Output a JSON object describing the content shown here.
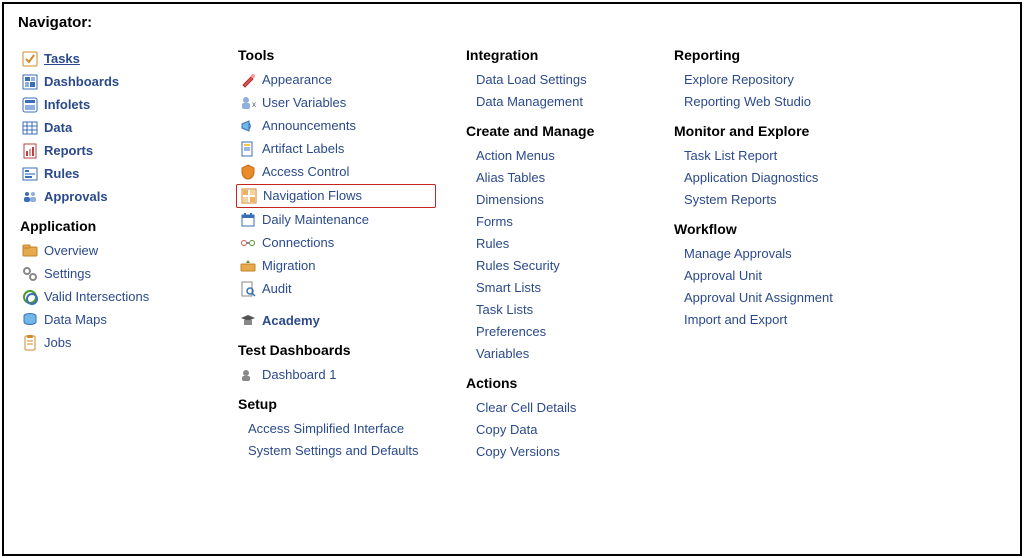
{
  "title": "Navigator:",
  "col1": {
    "primary": [
      {
        "name": "tasks",
        "label": "Tasks",
        "icon": "tasks",
        "active": true
      },
      {
        "name": "dashboards",
        "label": "Dashboards",
        "icon": "dashboards"
      },
      {
        "name": "infolets",
        "label": "Infolets",
        "icon": "infolets"
      },
      {
        "name": "data",
        "label": "Data",
        "icon": "data"
      },
      {
        "name": "reports",
        "label": "Reports",
        "icon": "reports"
      },
      {
        "name": "rules",
        "label": "Rules",
        "icon": "rules"
      },
      {
        "name": "approvals",
        "label": "Approvals",
        "icon": "approvals"
      }
    ],
    "application_heading": "Application",
    "application": [
      {
        "name": "overview",
        "label": "Overview",
        "icon": "overview"
      },
      {
        "name": "settings",
        "label": "Settings",
        "icon": "settings"
      },
      {
        "name": "valid-intersections",
        "label": "Valid Intersections",
        "icon": "intersections"
      },
      {
        "name": "data-maps",
        "label": "Data Maps",
        "icon": "datamaps"
      },
      {
        "name": "jobs",
        "label": "Jobs",
        "icon": "jobs"
      }
    ]
  },
  "col2": {
    "tools_heading": "Tools",
    "tools": [
      {
        "name": "appearance",
        "label": "Appearance",
        "icon": "appearance"
      },
      {
        "name": "user-variables",
        "label": "User Variables",
        "icon": "user-variables"
      },
      {
        "name": "announcements",
        "label": "Announcements",
        "icon": "announcements"
      },
      {
        "name": "artifact-labels",
        "label": "Artifact Labels",
        "icon": "artifact-labels"
      },
      {
        "name": "access-control",
        "label": "Access Control",
        "icon": "access-control"
      },
      {
        "name": "navigation-flows",
        "label": "Navigation Flows",
        "icon": "navigation-flows",
        "highlight": true
      },
      {
        "name": "daily-maintenance",
        "label": "Daily Maintenance",
        "icon": "daily-maintenance"
      },
      {
        "name": "connections",
        "label": "Connections",
        "icon": "connections"
      },
      {
        "name": "migration",
        "label": "Migration",
        "icon": "migration"
      },
      {
        "name": "audit",
        "label": "Audit",
        "icon": "audit"
      }
    ],
    "academy": {
      "label": "Academy",
      "icon": "academy"
    },
    "test_dashboards_heading": "Test Dashboards",
    "test_dashboards": [
      {
        "name": "dashboard-1",
        "label": "Dashboard 1",
        "icon": "dashboard-item"
      }
    ],
    "setup_heading": "Setup",
    "setup": [
      "Access Simplified Interface",
      "System Settings and Defaults"
    ]
  },
  "col3": {
    "integration_heading": "Integration",
    "integration": [
      "Data Load Settings",
      "Data Management"
    ],
    "create_manage_heading": "Create and Manage",
    "create_manage": [
      "Action Menus",
      "Alias Tables",
      "Dimensions",
      "Forms",
      "Rules",
      "Rules Security",
      "Smart Lists",
      "Task Lists",
      "Preferences",
      "Variables"
    ],
    "actions_heading": "Actions",
    "actions": [
      "Clear Cell Details",
      "Copy Data",
      "Copy Versions"
    ]
  },
  "col4": {
    "reporting_heading": "Reporting",
    "reporting": [
      "Explore Repository",
      "Reporting Web Studio"
    ],
    "monitor_heading": "Monitor and Explore",
    "monitor": [
      "Task List Report",
      "Application Diagnostics",
      "System Reports"
    ],
    "workflow_heading": "Workflow",
    "workflow": [
      "Manage Approvals",
      "Approval Unit",
      "Approval Unit Assignment",
      "Import and Export"
    ]
  }
}
